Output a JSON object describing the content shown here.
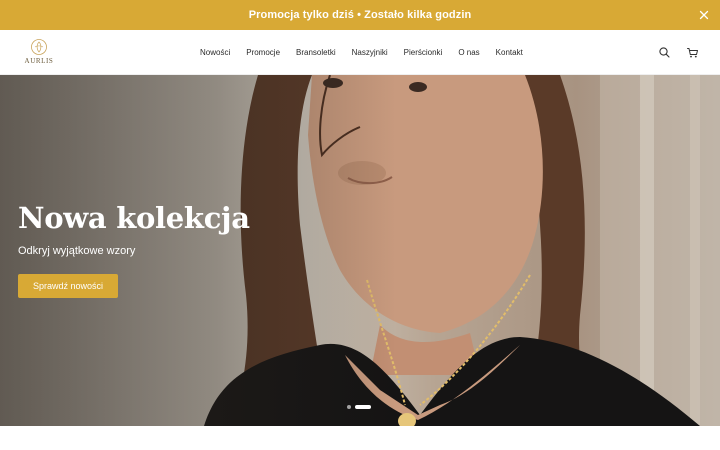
{
  "promo": {
    "text": "Promocja tylko dziś • Zostało kilka godzin",
    "close_icon": "close-icon"
  },
  "header": {
    "logo_text": "AURLIS",
    "nav": [
      {
        "label": "Nowości"
      },
      {
        "label": "Promocje"
      },
      {
        "label": "Bransoletki"
      },
      {
        "label": "Naszyjniki"
      },
      {
        "label": "Pierścionki"
      },
      {
        "label": "O nas"
      },
      {
        "label": "Kontakt"
      }
    ],
    "icons": [
      "search-icon",
      "cart-icon"
    ]
  },
  "hero": {
    "title": "Nowa kolekcja",
    "subtitle": "Odkryj wyjątkowe wzory",
    "cta_label": "Sprawdź nowości",
    "slides_total": 2,
    "active_slide": 2
  },
  "colors": {
    "accent": "#d8a935",
    "text": "#2b2b2b",
    "background": "#ffffff"
  }
}
